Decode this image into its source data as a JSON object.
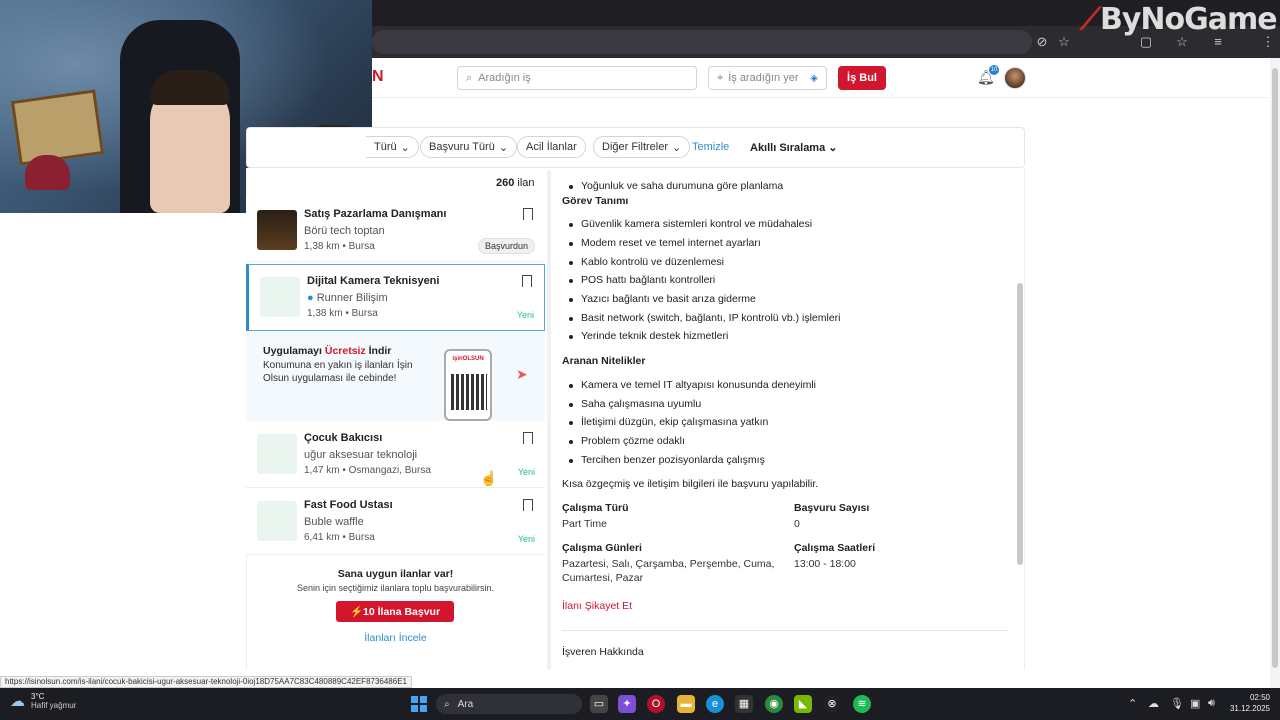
{
  "watermark": {
    "text": "ByNoGame"
  },
  "header": {
    "logo_fragment": "N",
    "search_placeholder": "Aradığın iş",
    "location_placeholder": "İş aradığın yer",
    "search_button": "İş Bul",
    "notification_count": "10"
  },
  "filters": {
    "chips": [
      "Türü",
      "Başvuru Türü",
      "Acil İlanlar",
      "Diğer Filtreler"
    ],
    "clear": "Temizle",
    "sort": "Akıllı Sıralama"
  },
  "list": {
    "count": "260",
    "count_suffix": "ilan",
    "jobs": [
      {
        "title": "Satış Pazarlama Danışmanı",
        "company": "Börü tech toptan",
        "location": "1,38 km • Bursa",
        "status": "Başvurdun"
      },
      {
        "title": "Dijital Kamera Teknisyeni",
        "company": "Runner Bilişim",
        "location": "1,38 km • Bursa",
        "status": "Yeni"
      },
      {
        "title": "Çocuk Bakıcısı",
        "company": "uğur aksesuar teknoloji",
        "location": "1,47 km • Osmangazi, Bursa",
        "status": "Yeni"
      },
      {
        "title": "Fast Food Ustası",
        "company": "Buble waffle",
        "location": "6,41 km • Bursa",
        "status": "Yeni"
      }
    ],
    "promo": {
      "title_pre": "Uygulamayı ",
      "title_red": "Ücretsiz",
      "title_post": " İndir",
      "text": "Konumuna en yakın iş ilanları İşin Olsun uygulaması ile cebinde!",
      "phone_label": "işinOLSUN"
    },
    "bulk": {
      "title": "Sana uygun ilanlar var!",
      "subtitle": "Senin için seçtiğimiz ilanlara toplu başvurabilirsin.",
      "button": "⚡10 İlana Başvur",
      "link": "İlanları İncele"
    }
  },
  "detail": {
    "bullet_top": "Yoğunluk ve saha durumuna göre planlama",
    "duties_heading": "Görev Tanımı",
    "duties": [
      "Güvenlik kamera sistemleri kontrol ve müdahalesi",
      "Modem reset ve temel internet ayarları",
      "Kablo kontrolü ve düzenlemesi",
      "POS hattı bağlantı kontrolleri",
      "Yazıcı bağlantı ve basit arıza giderme",
      "Basit network (switch, bağlantı, IP kontrolü vb.) işlemleri",
      "Yerinde teknik destek hizmetleri"
    ],
    "qual_heading": "Aranan Nitelikler",
    "quals": [
      "Kamera ve temel IT altyapısı konusunda deneyimli",
      "Saha çalışmasına uyumlu",
      "İletişimi düzgün, ekip çalışmasına yatkın",
      "Problem çözme odaklı",
      "Tercihen benzer pozisyonlarda çalışmış"
    ],
    "note": "Kısa özgeçmiş ve iletişim bilgileri ile başvuru yapılabilir.",
    "work_type_label": "Çalışma Türü",
    "work_type": "Part Time",
    "applicants_label": "Başvuru Sayısı",
    "applicants": "0",
    "days_label": "Çalışma Günleri",
    "days": "Pazartesi, Salı, Çarşamba, Perşembe, Cuma, Cumartesi, Pazar",
    "hours_label": "Çalışma Saatleri",
    "hours": "13:00 - 18:00",
    "report": "İlanı Şikayet Et",
    "employer_heading": "İşveren Hakkında"
  },
  "status_url": "https://isinolsun.com/is-ilani/cocuk-bakicisi-ugur-aksesuar-teknoloji-0ioj18D75AA7C83C480889C42EF8736486E1",
  "taskbar": {
    "temp": "3°C",
    "weather": "Hafif yağmur",
    "search": "Ara",
    "time": "02:50",
    "date": "31.12.2025"
  },
  "colors": {
    "brand_red": "#d2162e",
    "link_blue": "#2b8ec9",
    "new_green": "#2bbf7a"
  }
}
